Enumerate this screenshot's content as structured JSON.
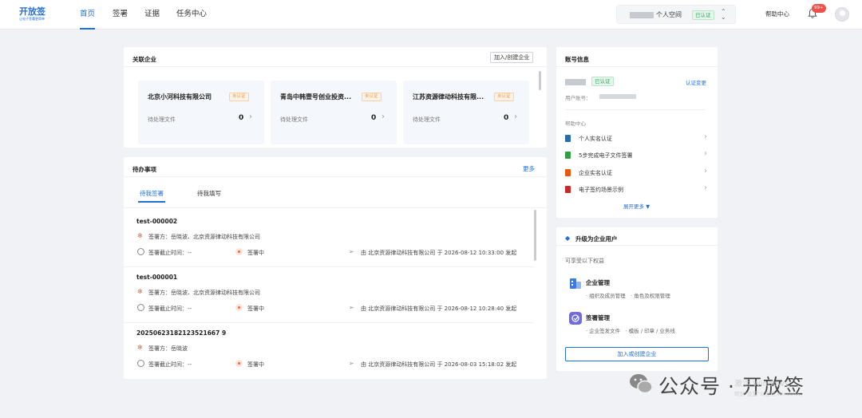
{
  "brand": {
    "logo_text": "开放签",
    "logo_tagline": "让电子签署更简单"
  },
  "nav": {
    "tabs": [
      {
        "label": "首页",
        "active": true
      },
      {
        "label": "签署",
        "active": false
      },
      {
        "label": "证据",
        "active": false
      },
      {
        "label": "任务中心",
        "active": false
      }
    ],
    "space": {
      "name": "个人空间",
      "verified": "已认证"
    },
    "help": "帮助中心",
    "notification_count": "99+"
  },
  "companies": {
    "title": "关联企业",
    "join_button": "加入/创建企业",
    "pending_label": "待处理文件",
    "items": [
      {
        "name": "北京小河科技有限公司",
        "status": "未认证",
        "pending": "0"
      },
      {
        "name": "青岛中韩壹号创业投资...",
        "status": "未认证",
        "pending": "0"
      },
      {
        "name": "江苏资源律动科技有限...",
        "status": "未认证",
        "pending": "0"
      }
    ]
  },
  "todo": {
    "title": "待办事项",
    "more": "更多",
    "tabs": [
      "待我签署",
      "待我填写"
    ],
    "docs": [
      {
        "name": "test-000002",
        "signers": "签署方：岳晓波、北京资源律动科技有限公司",
        "deadline": "签署截止时间：--",
        "status": "签署中",
        "sender": "由 北京资源律动科技有限公司 于 2026-08-12 10:33:00 发起"
      },
      {
        "name": "test-000001",
        "signers": "签署方：岳晓波、北京资源律动科技有限公司",
        "deadline": "签署截止时间：--",
        "status": "签署中",
        "sender": "由 北京资源律动科技有限公司 于 2026-08-12 10:28:40 发起"
      },
      {
        "name": "20250623182123521667 9",
        "signers": "签署方：岳晓波",
        "deadline": "签署截止时间：--",
        "status": "签署中",
        "sender": "由 北京资源律动科技有限公司 于 2026-08-03 15:18:02 发起"
      }
    ]
  },
  "account": {
    "title": "账号信息",
    "verified": "已认证",
    "change_verify": "认证变更",
    "user_label": "用户账号：",
    "help_label": "帮助中心",
    "help_items": [
      {
        "label": "个人实名认证",
        "color": "#2b6cb0"
      },
      {
        "label": "5步完成电子文件签署",
        "color": "#2f9e44"
      },
      {
        "label": "企业实名认证",
        "color": "#e8590c"
      },
      {
        "label": "电子签约场景示例",
        "color": "#c92a2a"
      }
    ],
    "expand": "展开更多 ▼"
  },
  "upgrade": {
    "title": "升级为企业用户",
    "subtitle": "可享受以下权益",
    "features": [
      {
        "title": "企业管理",
        "desc": "· 组织及成员管理　· 角色及权限管理"
      },
      {
        "title": "签署管理",
        "desc": "· 企业签发文件　· 模板 / 印章 / 业务线"
      }
    ],
    "button": "加入或创建企业"
  },
  "watermark": {
    "text": "公众号 · 开放签",
    "win_line1": "激活 Windows",
    "win_line2": "转到\"设置\"以激活 Windows。"
  }
}
